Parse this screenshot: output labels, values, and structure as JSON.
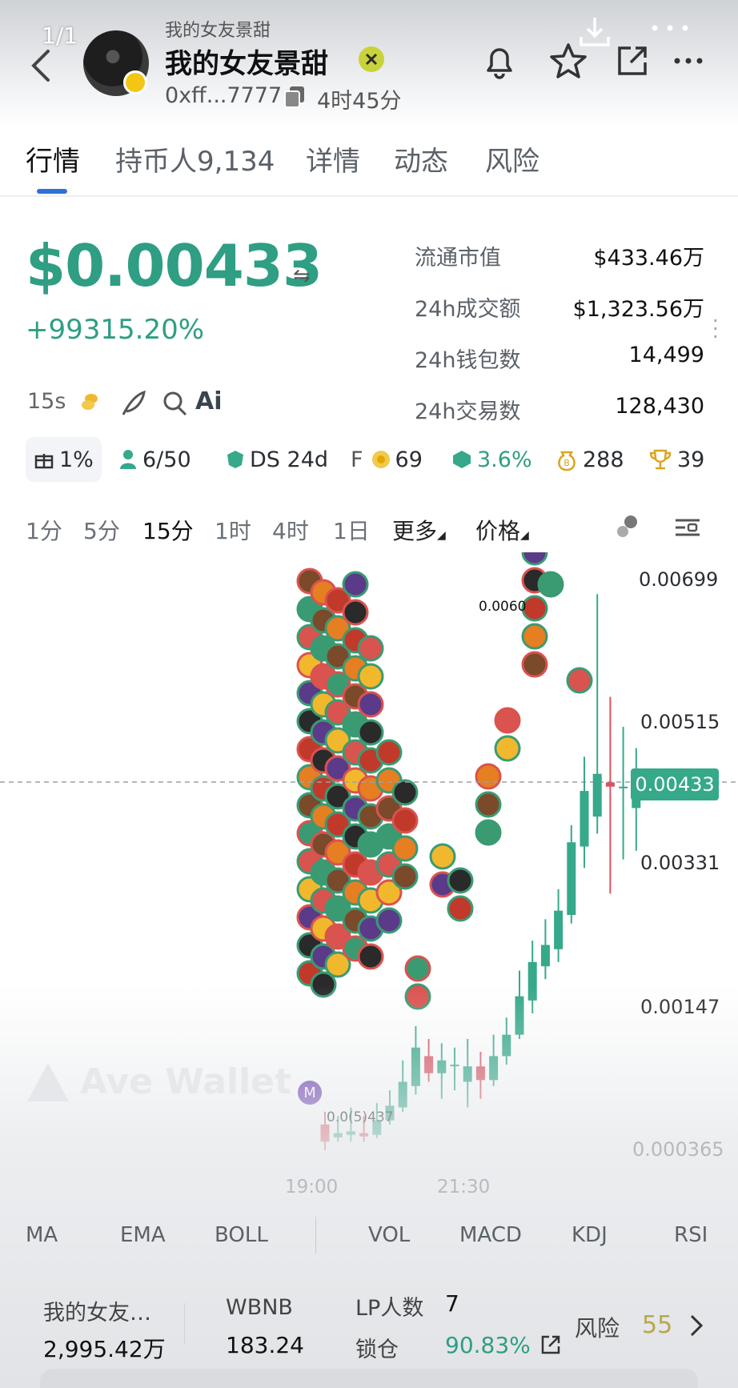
{
  "header": {
    "page_counter": "1/1",
    "small_title": "我的女友景甜",
    "title": "我的女友景甜",
    "address": "0xff...7777",
    "age": "4时45分"
  },
  "tabs": [
    {
      "label": "行情",
      "active": true
    },
    {
      "label": "持币人9,134"
    },
    {
      "label": "详情"
    },
    {
      "label": "动态"
    },
    {
      "label": "风险"
    }
  ],
  "price": {
    "value": "$0.00433",
    "change": "+99315.20%",
    "interval": "15s",
    "ai_label": "Ai"
  },
  "stats": [
    {
      "label": "流通市值",
      "value": "$433.46万"
    },
    {
      "label": "24h成交额",
      "value": "$1,323.56万"
    },
    {
      "label": "24h钱包数",
      "value": "14,499"
    },
    {
      "label": "24h交易数",
      "value": "128,430"
    }
  ],
  "badges": [
    {
      "icon": "gift-icon",
      "text": "1%"
    },
    {
      "icon": "user-icon",
      "text": "6/50"
    },
    {
      "icon": "shield-icon",
      "text": "DS 24d"
    },
    {
      "icon": "coin-icon",
      "prefix": "F",
      "text": "69"
    },
    {
      "icon": "cube-icon",
      "text": "3.6%"
    },
    {
      "icon": "bag-icon",
      "text": "288"
    },
    {
      "icon": "trophy-icon",
      "text": "39"
    }
  ],
  "timeframes": [
    {
      "label": "1分"
    },
    {
      "label": "5分"
    },
    {
      "label": "15分",
      "active": true
    },
    {
      "label": "1时"
    },
    {
      "label": "4时"
    },
    {
      "label": "1日"
    },
    {
      "label": "更多"
    },
    {
      "label": "价格"
    }
  ],
  "chart": {
    "price_labels": [
      "0.00699",
      "0.00515",
      "0.00331",
      "0.00147",
      "0.000365"
    ],
    "current_price": "0.00433",
    "high_marker": "0.0060",
    "low_marker": "0.0(5)437",
    "marker_letter": "M",
    "time_labels": [
      "19:00",
      "21:30"
    ],
    "watermark": "Ave Wallet",
    "colors": {
      "up": "#35a98a",
      "down": "#d9535f"
    }
  },
  "chart_data": {
    "type": "candlestick",
    "ylim": [
      0.000365,
      0.00699
    ],
    "x_ticks": [
      "19:00",
      "21:30"
    ],
    "y_ticks": [
      0.00699,
      0.00515,
      0.00331,
      0.00147,
      0.000365
    ],
    "candles": [
      {
        "o": 0.0006,
        "c": 0.0004,
        "h": 0.00075,
        "l": 0.0003
      },
      {
        "o": 0.00045,
        "c": 0.0005,
        "h": 0.0007,
        "l": 0.0004
      },
      {
        "o": 0.00048,
        "c": 0.00052,
        "h": 0.0008,
        "l": 0.0004
      },
      {
        "o": 0.0005,
        "c": 0.00046,
        "h": 0.0007,
        "l": 0.0004
      },
      {
        "o": 0.00048,
        "c": 0.00065,
        "h": 0.00085,
        "l": 0.00044
      },
      {
        "o": 0.00065,
        "c": 0.00082,
        "h": 0.001,
        "l": 0.0006
      },
      {
        "o": 0.0008,
        "c": 0.0011,
        "h": 0.00135,
        "l": 0.00075
      },
      {
        "o": 0.00105,
        "c": 0.0015,
        "h": 0.00175,
        "l": 0.00095
      },
      {
        "o": 0.0014,
        "c": 0.0012,
        "h": 0.0016,
        "l": 0.0011
      },
      {
        "o": 0.0012,
        "c": 0.00135,
        "h": 0.00155,
        "l": 0.0009
      },
      {
        "o": 0.0013,
        "c": 0.0013,
        "h": 0.0015,
        "l": 0.001
      },
      {
        "o": 0.0011,
        "c": 0.00128,
        "h": 0.0016,
        "l": 0.0008
      },
      {
        "o": 0.00128,
        "c": 0.00112,
        "h": 0.00145,
        "l": 0.0009
      },
      {
        "o": 0.00112,
        "c": 0.0014,
        "h": 0.00165,
        "l": 0.00105
      },
      {
        "o": 0.0014,
        "c": 0.00165,
        "h": 0.00185,
        "l": 0.0013
      },
      {
        "o": 0.00165,
        "c": 0.0021,
        "h": 0.0024,
        "l": 0.0016
      },
      {
        "o": 0.00205,
        "c": 0.0025,
        "h": 0.00275,
        "l": 0.0019
      },
      {
        "o": 0.00245,
        "c": 0.0027,
        "h": 0.003,
        "l": 0.0023
      },
      {
        "o": 0.00265,
        "c": 0.0031,
        "h": 0.00335,
        "l": 0.0025
      },
      {
        "o": 0.00305,
        "c": 0.0039,
        "h": 0.0041,
        "l": 0.00295
      },
      {
        "o": 0.00385,
        "c": 0.0045,
        "h": 0.0049,
        "l": 0.0036
      },
      {
        "o": 0.0042,
        "c": 0.0047,
        "h": 0.0068,
        "l": 0.004
      },
      {
        "o": 0.0046,
        "c": 0.00455,
        "h": 0.0056,
        "l": 0.0033
      },
      {
        "o": 0.00455,
        "c": 0.00455,
        "h": 0.00525,
        "l": 0.0037
      },
      {
        "o": 0.0043,
        "c": 0.00448,
        "h": 0.005,
        "l": 0.0038
      }
    ]
  },
  "indicators": [
    "MA",
    "EMA",
    "BOLL",
    "VOL",
    "MACD",
    "KDJ",
    "RSI"
  ],
  "bottom": {
    "token_label": "我的女友…",
    "token_value": "2,995.42万",
    "pair_label": "WBNB",
    "pair_value": "183.24",
    "lp_label": "LP人数",
    "lp_value": "7",
    "lock_label": "锁仓",
    "lock_value": "90.83%",
    "risk_label": "风险",
    "risk_value": "55"
  }
}
